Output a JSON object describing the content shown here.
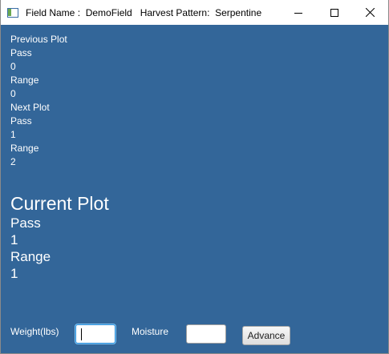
{
  "window": {
    "title": "Field Name :  DemoField   Harvest Pattern:  Serpentine"
  },
  "previous_plot": {
    "heading": "Previous Plot",
    "pass_label": "Pass",
    "pass_value": "0",
    "range_label": "Range",
    "range_value": "0"
  },
  "next_plot": {
    "heading": "Next Plot",
    "pass_label": "Pass",
    "pass_value": "1",
    "range_label": "Range",
    "range_value": "2"
  },
  "current_plot": {
    "heading": "Current Plot",
    "pass_label": "Pass",
    "pass_value": "1",
    "range_label": "Range",
    "range_value": "1"
  },
  "form": {
    "weight_label": "Weight(lbs)",
    "weight_value": "",
    "moisture_label": "Moisture",
    "moisture_value": "",
    "advance_label": "Advance"
  },
  "colors": {
    "background": "#336699",
    "text": "#ffffff",
    "focus_ring": "#2a8ad4"
  }
}
